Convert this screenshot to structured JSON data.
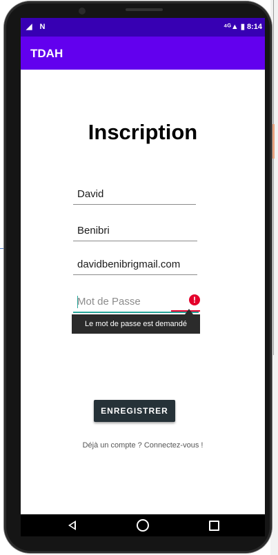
{
  "status_bar": {
    "left_icons": "◢ N",
    "right": "⁴ᴳ▲ ▮ 8:14"
  },
  "app_bar": {
    "title": "TDAH"
  },
  "form": {
    "heading": "Inscription",
    "first_name": "David",
    "last_name": "Benibri",
    "email": "davidbenibrigmail.com",
    "password_placeholder": "Mot de Passe",
    "password_error": "Le mot de passe est demandé",
    "error_icon": "!",
    "submit_label": "ENREGISTRER",
    "login_link": "Déjà un compte ? Connectez-vous !"
  },
  "colors": {
    "status_bar": "#3700b3",
    "app_bar": "#6200ee",
    "accent": "#26a69a",
    "error": "#e4002b",
    "button": "#263238"
  },
  "nav": {
    "back": "back-icon",
    "home": "home-icon",
    "recent": "recent-apps-icon"
  }
}
